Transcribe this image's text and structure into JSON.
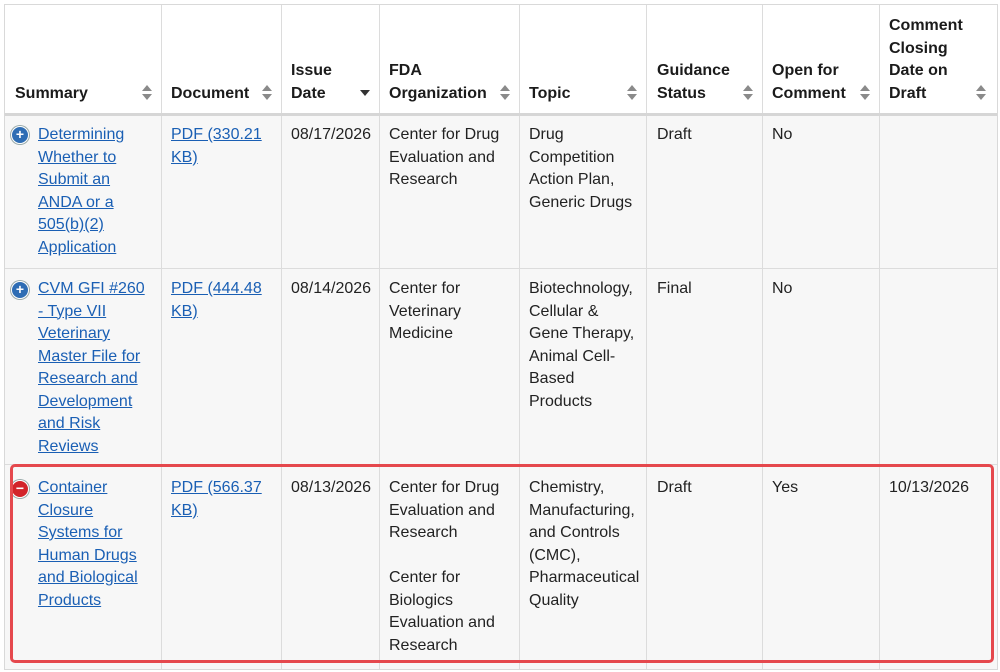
{
  "table": {
    "headers": [
      {
        "label": "Summary"
      },
      {
        "label": "Document"
      },
      {
        "label": "Issue Date"
      },
      {
        "label": "FDA Organization"
      },
      {
        "label": "Topic"
      },
      {
        "label": "Guidance Status"
      },
      {
        "label": "Open for Comment"
      },
      {
        "label": "Comment Closing Date on Draft"
      }
    ],
    "rows": [
      {
        "toggle": "+",
        "summary": "Determining Whether to Submit an ANDA or a 505(b)(2) Application",
        "document": "PDF (330.21 KB)",
        "issue_date": "08/17/2026",
        "organizations": [
          "Center for Drug Evaluation and Research"
        ],
        "topic": "Drug Competition Action Plan, Generic Drugs",
        "status": "Draft",
        "open_for_comment": "No",
        "closing_date": ""
      },
      {
        "toggle": "+",
        "summary": "CVM GFI #260 - Type VII Veterinary Master File for Research and Development and Risk Reviews",
        "document": "PDF (444.48 KB)",
        "issue_date": "08/14/2026",
        "organizations": [
          "Center for Veterinary Medicine"
        ],
        "topic": "Biotechnology, Cellular & Gene Therapy, Animal Cell-Based Products",
        "status": "Final",
        "open_for_comment": "No",
        "closing_date": ""
      },
      {
        "toggle": "−",
        "summary": "Container Closure Systems for Human Drugs and Biological Products",
        "document": "PDF (566.37 KB)",
        "issue_date": "08/13/2026",
        "organizations": [
          "Center for Drug Evaluation and Research",
          "Center for Biologics Evaluation and Research"
        ],
        "topic": "Chemistry, Manufacturing, and Controls (CMC), Pharmaceutical Quality",
        "status": "Draft",
        "open_for_comment": "Yes",
        "closing_date": "10/13/2026"
      }
    ]
  },
  "colors": {
    "link": "#1a5fb4",
    "highlight": "#e5484d",
    "expand_icon": "#2e6db4",
    "collapse_icon": "#d2232a"
  }
}
